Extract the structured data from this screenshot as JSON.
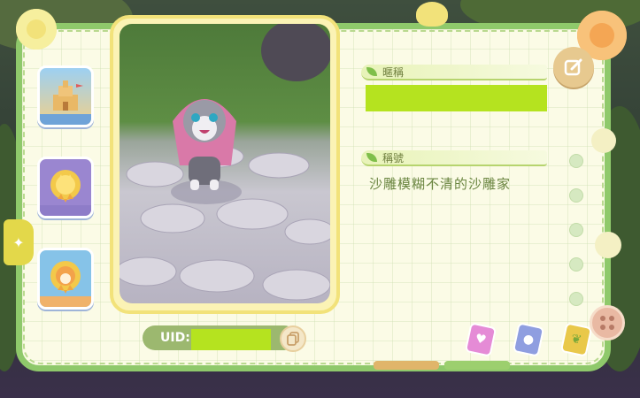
{
  "profile": {
    "nickname_label": "暱稱",
    "nickname_value": "",
    "title_label": "稱號",
    "title_value": "沙雕模糊不清的沙雕家",
    "uid_label": "UID:",
    "uid_value": ""
  },
  "badges": [
    {
      "name": "sandcastle-badge",
      "color": "#7fb7e8"
    },
    {
      "name": "cat-medal-badge",
      "color": "#a78bd6"
    },
    {
      "name": "shiba-medal-badge",
      "color": "#7fb7e8"
    }
  ],
  "colors": {
    "frame_green": "#8fc96b",
    "paper": "#fbfbe6",
    "redacted_lime": "#b5e31f",
    "photo_frame": "#f2e27a"
  },
  "icons": {
    "edit": "pencil-square-icon",
    "copy": "copy-icon",
    "more": "button-dots-icon",
    "side_tab": "sparkle-icon"
  },
  "cards": [
    {
      "name": "pink-heart-card",
      "color": "#e58bd6"
    },
    {
      "name": "blue-orb-card",
      "color": "#8f9ee0"
    },
    {
      "name": "yellow-leaf-card",
      "color": "#e9c84a"
    }
  ]
}
